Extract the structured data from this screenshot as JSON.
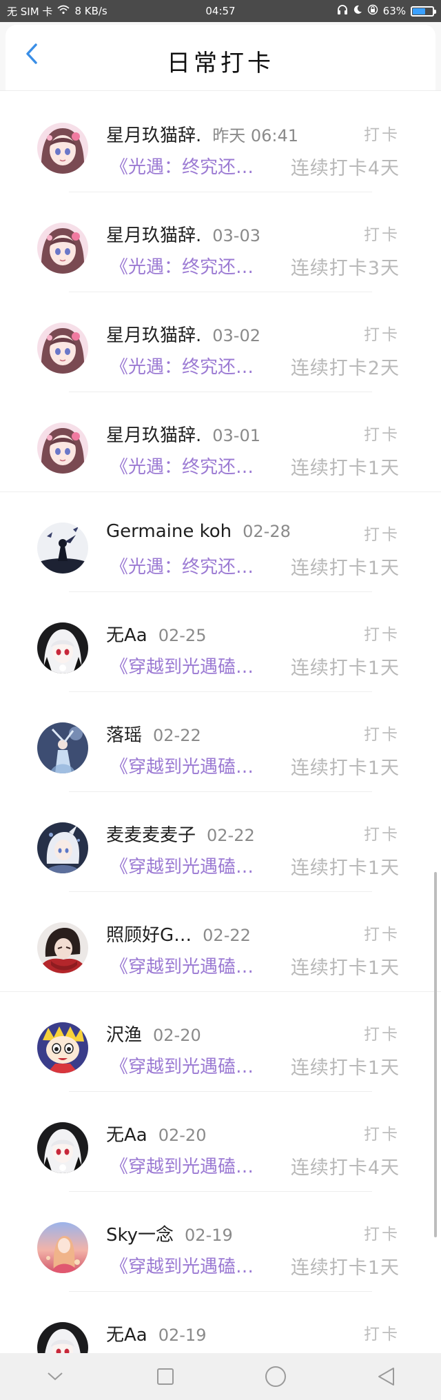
{
  "status_bar": {
    "carrier": "无 SIM 卡",
    "speed": "8 KB/s",
    "time": "04:57",
    "battery": "63%",
    "battery_level": 0.63
  },
  "header": {
    "title": "日常打卡"
  },
  "colors": {
    "accent": "#3a8ee6",
    "book_title": "#9b7ad3",
    "muted": "#b8b8b8"
  },
  "entries": [
    {
      "name": "星月玖猫辞.",
      "date": "昨天 06:41",
      "action": "打卡",
      "book": "《光遇：终究还…",
      "streak": "连续打卡4天",
      "avatar": "anime-girl-pink-avatar"
    },
    {
      "name": "星月玖猫辞.",
      "date": "03-03",
      "action": "打卡",
      "book": "《光遇：终究还…",
      "streak": "连续打卡3天",
      "avatar": "anime-girl-pink-avatar"
    },
    {
      "name": "星月玖猫辞.",
      "date": "03-02",
      "action": "打卡",
      "book": "《光遇：终究还…",
      "streak": "连续打卡2天",
      "avatar": "anime-girl-pink-avatar"
    },
    {
      "name": "星月玖猫辞.",
      "date": "03-01",
      "action": "打卡",
      "book": "《光遇：终究还…",
      "streak": "连续打卡1天",
      "avatar": "anime-girl-pink-avatar"
    },
    {
      "name": "Germaine koh",
      "date": "02-28",
      "action": "打卡",
      "book": "《光遇：终究还…",
      "streak": "连续打卡1天",
      "avatar": "sky-silhouette-avatar"
    },
    {
      "name": "无Aa",
      "date": "02-25",
      "action": "打卡",
      "book": "《穿越到光遇磕…",
      "streak": "连续打卡1天",
      "avatar": "white-hair-hood-avatar"
    },
    {
      "name": "落瑶",
      "date": "02-22",
      "action": "打卡",
      "book": "《穿越到光遇磕…",
      "streak": "连续打卡1天",
      "avatar": "blue-dancer-avatar"
    },
    {
      "name": "麦麦麦麦子",
      "date": "02-22",
      "action": "打卡",
      "book": "《穿越到光遇磕…",
      "streak": "连续打卡1天",
      "avatar": "white-hair-boy-avatar"
    },
    {
      "name": "照顾好G…",
      "date": "02-22",
      "action": "打卡",
      "book": "《穿越到光遇磕…",
      "streak": "连续打卡1天",
      "avatar": "red-scarf-avatar"
    },
    {
      "name": "沢渔",
      "date": "02-20",
      "action": "打卡",
      "book": "《穿越到光遇磕…",
      "streak": "连续打卡1天",
      "avatar": "pop-team-avatar"
    },
    {
      "name": "无Aa",
      "date": "02-20",
      "action": "打卡",
      "book": "《穿越到光遇磕…",
      "streak": "连续打卡4天",
      "avatar": "white-hair-hood-avatar"
    },
    {
      "name": "Sky一念",
      "date": "02-19",
      "action": "打卡",
      "book": "《穿越到光遇磕…",
      "streak": "连续打卡1天",
      "avatar": "sunset-girl-avatar"
    },
    {
      "name": "无Aa",
      "date": "02-19",
      "action": "打卡",
      "book": "",
      "streak": "",
      "avatar": "white-hair-hood-avatar"
    }
  ]
}
